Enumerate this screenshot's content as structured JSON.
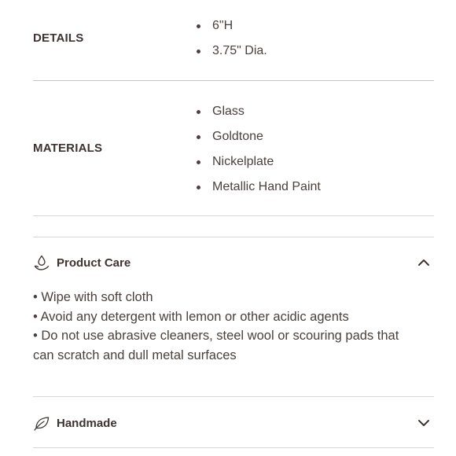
{
  "details": {
    "label": "DETAILS",
    "items": [
      "6\"H",
      "3.75\" Dia."
    ]
  },
  "materials": {
    "label": "MATERIALS",
    "items": [
      "Glass",
      "Goldtone",
      "Nickelplate",
      "Metallic Hand Paint"
    ]
  },
  "product_care": {
    "icon": "water-drop-hand-icon",
    "title": "Product Care",
    "expanded": true,
    "lines": [
      "• Wipe with soft cloth",
      "• Avoid any detergent with lemon or other acidic agents",
      "• Do not use abrasive cleaners, steel wool or scouring pads that can scratch and dull metal surfaces"
    ]
  },
  "handmade": {
    "icon": "leaf-icon",
    "title": "Handmade",
    "expanded": false
  }
}
